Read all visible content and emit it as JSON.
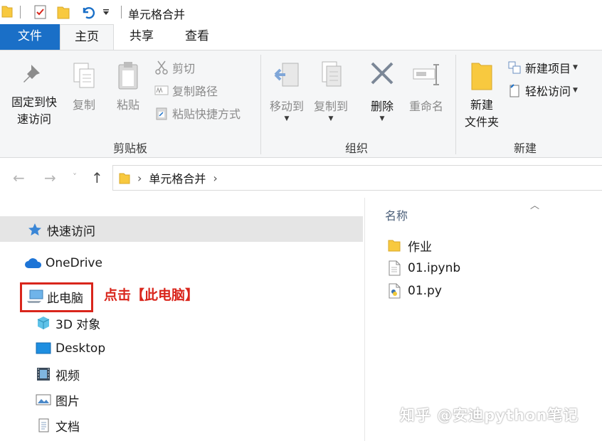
{
  "window": {
    "title": "单元格合并"
  },
  "ribbon_tabs": [
    {
      "label": "文件",
      "active": false
    },
    {
      "label": "主页",
      "active": true
    },
    {
      "label": "共享",
      "active": false
    },
    {
      "label": "查看",
      "active": false
    }
  ],
  "ribbon": {
    "clipboard": {
      "pin_label": "固定到快\n速访问",
      "copy_label": "复制",
      "paste_label": "粘贴",
      "cut_label": "剪切",
      "copy_path_label": "复制路径",
      "paste_shortcut_label": "粘贴快捷方式",
      "group_label": "剪贴板"
    },
    "organize": {
      "move_to_label": "移动到",
      "copy_to_label": "复制到",
      "delete_label": "删除",
      "rename_label": "重命名",
      "group_label": "组织"
    },
    "new": {
      "new_folder_label": "新建\n文件夹",
      "new_item_label": "新建项目",
      "easy_access_label": "轻松访问",
      "group_label": "新建"
    }
  },
  "address": {
    "path": [
      "单元格合并"
    ]
  },
  "nav_pane": {
    "items": [
      {
        "label": "快速访问",
        "icon": "star-icon"
      },
      {
        "label": "OneDrive",
        "icon": "cloud-icon"
      },
      {
        "label": "此电脑",
        "icon": "computer-icon"
      },
      {
        "label": "3D 对象",
        "icon": "cube-icon"
      },
      {
        "label": "Desktop",
        "icon": "desktop-icon"
      },
      {
        "label": "视频",
        "icon": "video-icon"
      },
      {
        "label": "图片",
        "icon": "picture-icon"
      },
      {
        "label": "文档",
        "icon": "document-icon"
      }
    ]
  },
  "annotation": {
    "text": "点击【此电脑】",
    "color": "#d9261c"
  },
  "file_list": {
    "column_name": "名称",
    "files": [
      {
        "name": "作业",
        "icon": "folder-icon"
      },
      {
        "name": "01.ipynb",
        "icon": "file-icon"
      },
      {
        "name": "01.py",
        "icon": "python-file-icon"
      }
    ]
  },
  "watermark": {
    "text": "知乎 @安迪python笔记"
  },
  "colors": {
    "accent": "#1a6fc7",
    "folder": "#f8c93f",
    "highlight": "#e5e5e5"
  }
}
